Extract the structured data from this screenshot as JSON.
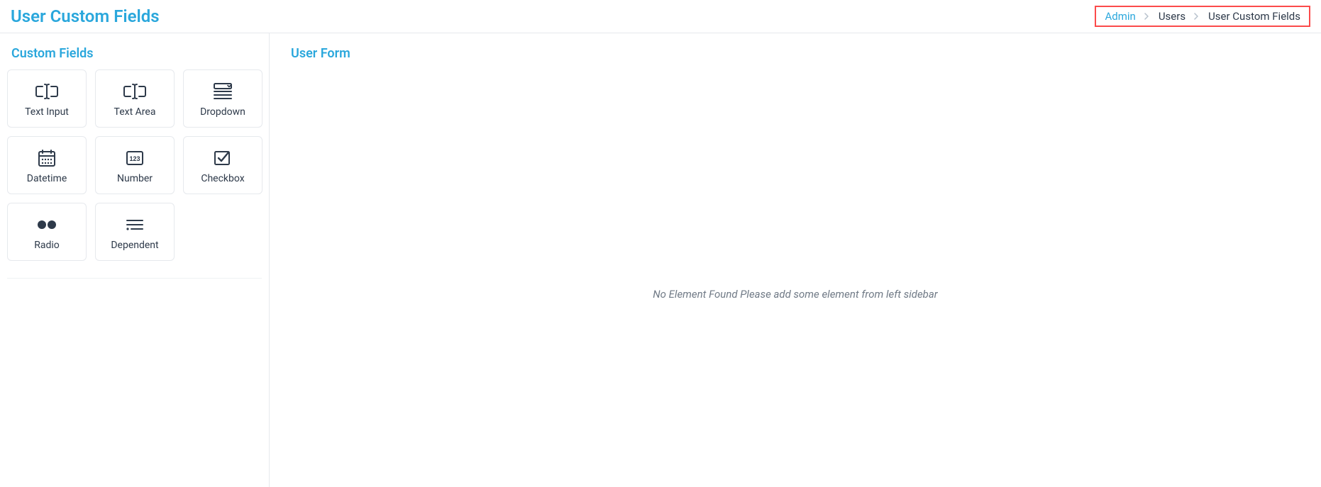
{
  "header": {
    "title": "User Custom Fields",
    "breadcrumb": [
      {
        "label": "Admin",
        "link": true
      },
      {
        "label": "Users",
        "link": false
      },
      {
        "label": "User Custom Fields",
        "link": false
      }
    ]
  },
  "sidebar": {
    "title": "Custom Fields",
    "fields": [
      {
        "label": "Text Input",
        "icon": "text-input-icon"
      },
      {
        "label": "Text Area",
        "icon": "text-area-icon"
      },
      {
        "label": "Dropdown",
        "icon": "dropdown-icon"
      },
      {
        "label": "Datetime",
        "icon": "datetime-icon"
      },
      {
        "label": "Number",
        "icon": "number-icon"
      },
      {
        "label": "Checkbox",
        "icon": "checkbox-icon"
      },
      {
        "label": "Radio",
        "icon": "radio-icon"
      },
      {
        "label": "Dependent",
        "icon": "dependent-icon"
      }
    ]
  },
  "main": {
    "title": "User Form",
    "empty_message": "No Element Found Please add some element from left sidebar"
  }
}
